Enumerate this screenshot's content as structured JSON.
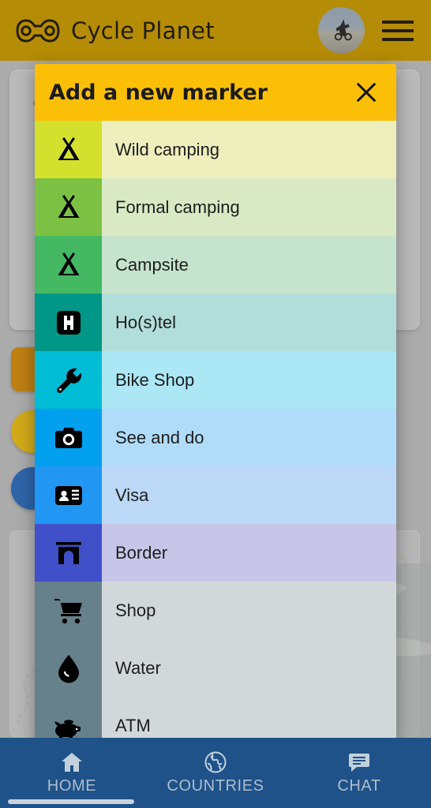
{
  "topbar": {
    "logo_icon": "bike-chain-icon",
    "title": "Cycle Planet",
    "avatar_icon": "user-avatar",
    "menu_icon": "hamburger-menu-icon",
    "bg_color": "#b58c06"
  },
  "background": {
    "card_heading": "•"
  },
  "modal": {
    "title": "Add a new marker",
    "close_icon": "close-icon",
    "header_color": "#fcbf07",
    "items": [
      {
        "label": "Wild camping",
        "icon": "tent-icon",
        "icon_bg": "#d4e02e",
        "row_bg": "#eeefbd"
      },
      {
        "label": "Formal camping",
        "icon": "tent-icon",
        "icon_bg": "#7cc143",
        "row_bg": "#d9e9c4"
      },
      {
        "label": "Campsite",
        "icon": "tent-icon",
        "icon_bg": "#44b862",
        "row_bg": "#c5e3cd"
      },
      {
        "label": "Ho(s)tel",
        "icon": "hostel-h-icon",
        "icon_bg": "#009688",
        "row_bg": "#b2ded9"
      },
      {
        "label": "Bike Shop",
        "icon": "wrench-icon",
        "icon_bg": "#00bcd4",
        "row_bg": "#ace7f5"
      },
      {
        "label": "See and do",
        "icon": "camera-icon",
        "icon_bg": "#00a0ef",
        "row_bg": "#b0dcfa"
      },
      {
        "label": "Visa",
        "icon": "id-card-icon",
        "icon_bg": "#2196f3",
        "row_bg": "#bcd9f7"
      },
      {
        "label": "Border",
        "icon": "gate-arch-icon",
        "icon_bg": "#4050c8",
        "row_bg": "#c7c6e8"
      },
      {
        "label": "Shop",
        "icon": "shopping-cart-icon",
        "icon_bg": "#66818c",
        "row_bg": "#d2d8da"
      },
      {
        "label": "Water",
        "icon": "water-drop-icon",
        "icon_bg": "#66818c",
        "row_bg": "#d2d8da"
      },
      {
        "label": "ATM",
        "icon": "piggy-bank-icon",
        "icon_bg": "#66818c",
        "row_bg": "#d2d8da"
      }
    ]
  },
  "bottom_nav": {
    "bg_color": "#1f5288",
    "items": [
      {
        "label": "HOME",
        "icon": "home-icon"
      },
      {
        "label": "COUNTRIES",
        "icon": "globe-icon"
      },
      {
        "label": "CHAT",
        "icon": "chat-bubble-icon"
      }
    ]
  }
}
